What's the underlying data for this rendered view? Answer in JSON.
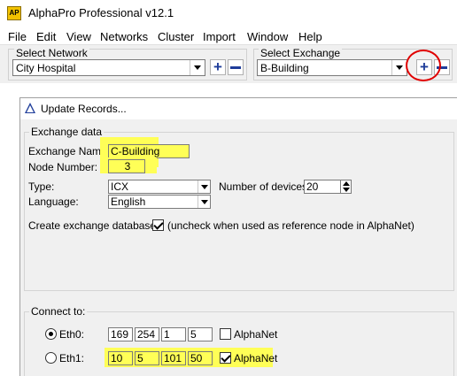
{
  "app": {
    "icon_text": "AP",
    "title": "AlphaPro Professional v12.1"
  },
  "menu": [
    "File",
    "Edit",
    "View",
    "Networks",
    "Cluster",
    "Import",
    "Window",
    "Help"
  ],
  "toolbar": {
    "network_label": "Select Network",
    "network_value": "City Hospital",
    "exchange_label": "Select Exchange",
    "exchange_value": "B-Building",
    "add_glyph": "+"
  },
  "dialog": {
    "title": "Update Records...",
    "exchange_data": {
      "section_label": "Exchange data",
      "exchange_name_label": "Exchange Name:",
      "exchange_name_value": "C-Building",
      "node_number_label": "Node Number:",
      "node_number_value": "3",
      "type_label": "Type:",
      "type_value": "ICX",
      "devices_label": "Number of devices:",
      "devices_value": "20",
      "language_label": "Language:",
      "language_value": "English",
      "create_db_label": "Create exchange database",
      "create_db_note": "(uncheck when used as reference node in AlphaNet)",
      "create_db_checked": true
    },
    "connect": {
      "section_label": "Connect to:",
      "eth0": {
        "label": "Eth0:",
        "selected": true,
        "ip": [
          "169",
          "254",
          "1",
          "5"
        ],
        "alphanet_label": "AlphaNet",
        "alphanet_checked": false
      },
      "eth1": {
        "label": "Eth1:",
        "selected": false,
        "ip": [
          "10",
          "5",
          "101",
          "50"
        ],
        "alphanet_label": "AlphaNet",
        "alphanet_checked": true
      }
    }
  },
  "colors": {
    "highlight": "#ffff57",
    "annotation_circle": "#e00000",
    "button_blue": "#1f3d9a"
  }
}
